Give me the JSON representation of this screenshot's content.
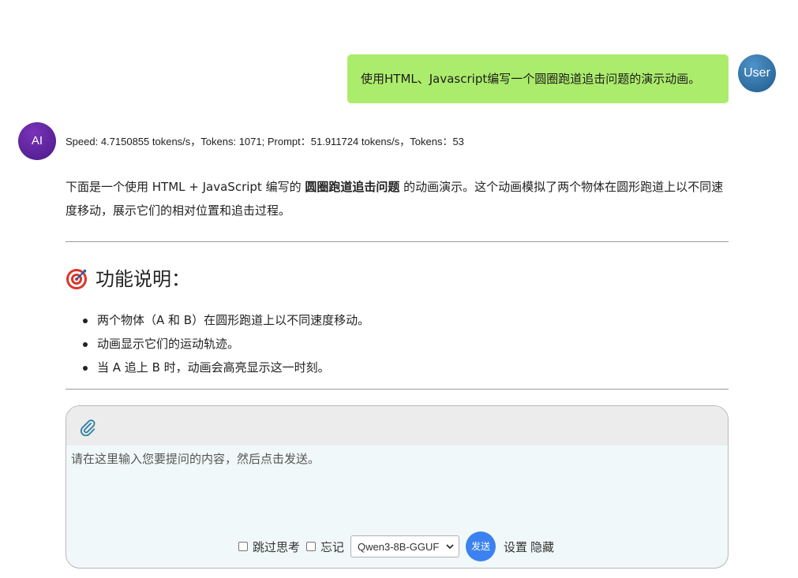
{
  "user_message": {
    "text": "使用HTML、Javascript编写一个圆圈跑道追击问题的演示动画。",
    "avatar": "User"
  },
  "ai_message": {
    "avatar": "AI",
    "stats": "Speed: 4.7150855 tokens/s，Tokens: 1071; Prompt：51.911724 tokens/s，Tokens：53",
    "intro_part1": "下面是一个使用 HTML + JavaScript 编写的 ",
    "intro_bold": "圆圈跑道追击问题",
    "intro_part2": " 的动画演示。这个动画模拟了两个物体在圆形跑道上以不同速度移动，展示它们的相对位置和追击过程。",
    "section_title": "功能说明：",
    "section_icon": "target-icon",
    "bullets": [
      "两个物体（A 和 B）在圆形跑道上以不同速度移动。",
      "动画显示它们的运动轨迹。",
      "当 A 追上 B 时，动画会高亮显示这一时刻。"
    ]
  },
  "composer": {
    "placeholder": "请在这里输入您要提问的内容，然后点击发送。",
    "attach_icon": "paperclip-icon",
    "skip_thinking_label": "跳过思考",
    "forget_label": "忘记",
    "model_selected": "Qwen3-8B-GGUF",
    "send_label": "发送",
    "settings_label": "设置",
    "hide_label": "隐藏"
  },
  "colors": {
    "user_bubble": "#acec6c",
    "user_avatar": "#2b6ea3",
    "ai_avatar": "#5b2299",
    "send_button": "#3b82f0"
  }
}
